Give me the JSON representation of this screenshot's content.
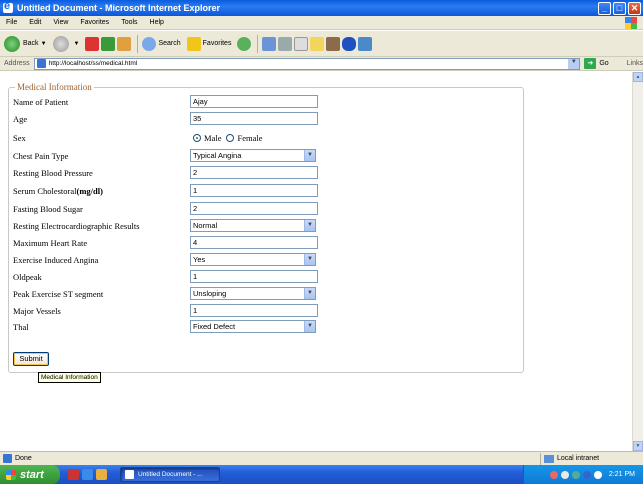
{
  "window": {
    "title": "Untitled Document - Microsoft Internet Explorer"
  },
  "menu": [
    "File",
    "Edit",
    "View",
    "Favorites",
    "Tools",
    "Help"
  ],
  "toolbar": {
    "back": "Back",
    "search": "Search",
    "favorites": "Favorites"
  },
  "address": {
    "label": "Address",
    "url": "http://localhost/ss/medical.html",
    "go": "Go",
    "links": "Links"
  },
  "form": {
    "legend": "Medical Information",
    "fields": [
      {
        "label": "Name of Patient",
        "value": "Ajay"
      },
      {
        "label": "Age",
        "value": "35"
      },
      {
        "label": "Sex"
      },
      {
        "label": "Chest Pain Type",
        "value": "Typical Angina"
      },
      {
        "label": "Resting Blood Pressure",
        "value": "2"
      },
      {
        "label": "Serum Cholestoral",
        "label_unit": "(mg/dl)",
        "value": "1"
      },
      {
        "label": "Fasting Blood Sugar",
        "value": "2"
      },
      {
        "label": "Resting Electrocardiographic Results",
        "value": "Normal"
      },
      {
        "label": "Maximum Heart Rate",
        "value": "4"
      },
      {
        "label": "Exercise Induced Angina",
        "value": "Yes"
      },
      {
        "label": "Oldpeak",
        "value": "1"
      },
      {
        "label": "Peak Exercise ST segment",
        "value": "Unsloping"
      },
      {
        "label": "Major Vessels",
        "value": "1"
      },
      {
        "label": "Thal",
        "value": "Fixed Defect"
      }
    ],
    "sex_options": [
      "Male",
      "Female"
    ],
    "sex_selected": "Male",
    "submit": "Submit",
    "tooltip": "Medical Information"
  },
  "status": {
    "text": "Done",
    "zone": "Local intranet"
  },
  "taskbar": {
    "start": "start",
    "task": "Untitled Document - ...",
    "time": "2:21 PM"
  }
}
